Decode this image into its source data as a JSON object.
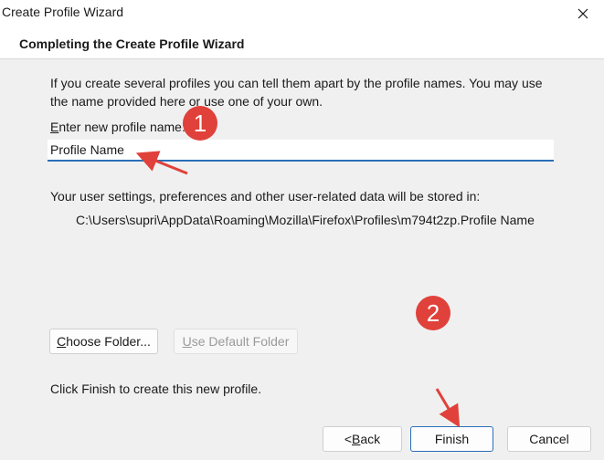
{
  "window": {
    "title": "Create Profile Wizard",
    "close_icon": "close-icon"
  },
  "header": {
    "title": "Completing the Create Profile Wizard"
  },
  "content": {
    "intro": "If you create several profiles you can tell them apart by the profile names. You may use the name provided here or use one of your own.",
    "name_label_accel": "E",
    "name_label_rest": "nter new profile name:",
    "name_value": "Profile Name",
    "storage_label": "Your user settings, preferences and other user-related data will be stored in:",
    "storage_path": "C:\\Users\\supri\\AppData\\Roaming\\Mozilla\\Firefox\\Profiles\\m794t2zp.Profile Name",
    "choose_folder_accel": "C",
    "choose_folder_rest": "hoose Folder...",
    "use_default_accel": "U",
    "use_default_rest": "se Default Folder",
    "finish_note": "Click Finish to create this new profile."
  },
  "footer": {
    "back_prefix": "< ",
    "back_accel": "B",
    "back_rest": "ack",
    "finish_label": "Finish",
    "cancel_label": "Cancel"
  },
  "annotations": {
    "badge1": "1",
    "badge2": "2",
    "color": "#e0413a"
  }
}
